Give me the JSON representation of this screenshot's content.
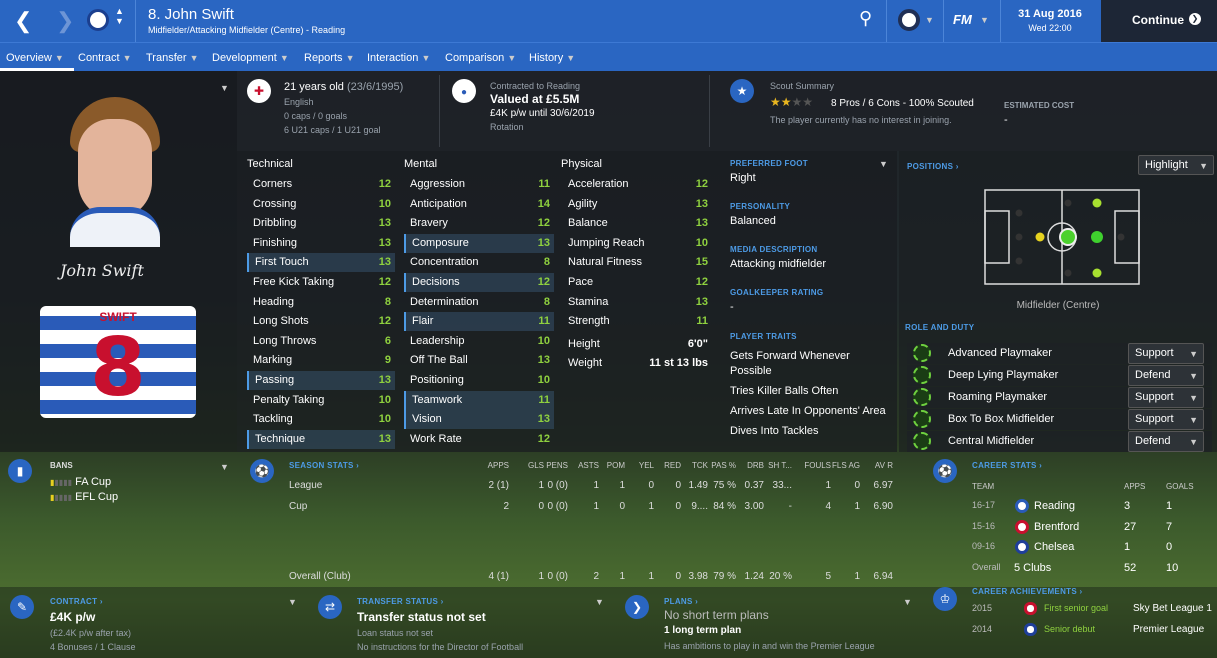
{
  "header": {
    "title": "8. John Swift",
    "subtitle": "Midfielder/Attacking Midfielder (Centre) - Reading",
    "date": "31 Aug 2016",
    "time": "Wed 22:00",
    "continue_label": "Continue",
    "fm_label": "FM"
  },
  "nav": [
    "Overview",
    "Contract",
    "Transfer",
    "Development",
    "Reports",
    "Interaction",
    "Comparison",
    "History"
  ],
  "profile": {
    "age": "21 years old",
    "dob": "(23/6/1995)",
    "nationality": "English",
    "caps": "0 caps / 0 goals",
    "u21": "6 U21 caps / 1 U21 goal",
    "signature": "John Swift",
    "shirt_name": "SWIFT",
    "shirt_number": "8"
  },
  "contract_top": {
    "label": "Contracted to Reading",
    "value": "Valued at £5.5M",
    "wage": "£4K p/w until 30/6/2019",
    "role": "Rotation"
  },
  "scout": {
    "title": "Scout Summary",
    "summary": "8 Pros / 6 Cons - 100% Scouted",
    "interest": "The player currently has no interest in joining.",
    "cost_label": "ESTIMATED COST",
    "cost": "-",
    "stars": 2,
    "max_stars": 4
  },
  "attributes": {
    "technical_title": "Technical",
    "mental_title": "Mental",
    "physical_title": "Physical",
    "technical": [
      [
        "Corners",
        "12"
      ],
      [
        "Crossing",
        "10"
      ],
      [
        "Dribbling",
        "13"
      ],
      [
        "Finishing",
        "13"
      ],
      [
        "First Touch",
        "13"
      ],
      [
        "Free Kick Taking",
        "12"
      ],
      [
        "Heading",
        "8"
      ],
      [
        "Long Shots",
        "12"
      ],
      [
        "Long Throws",
        "6"
      ],
      [
        "Marking",
        "9"
      ],
      [
        "Passing",
        "13"
      ],
      [
        "Penalty Taking",
        "10"
      ],
      [
        "Tackling",
        "10"
      ],
      [
        "Technique",
        "13"
      ]
    ],
    "mental": [
      [
        "Aggression",
        "11"
      ],
      [
        "Anticipation",
        "14"
      ],
      [
        "Bravery",
        "12"
      ],
      [
        "Composure",
        "13"
      ],
      [
        "Concentration",
        "8"
      ],
      [
        "Decisions",
        "12"
      ],
      [
        "Determination",
        "8"
      ],
      [
        "Flair",
        "11"
      ],
      [
        "Leadership",
        "10"
      ],
      [
        "Off The Ball",
        "13"
      ],
      [
        "Positioning",
        "10"
      ],
      [
        "Teamwork",
        "11"
      ],
      [
        "Vision",
        "13"
      ],
      [
        "Work Rate",
        "12"
      ]
    ],
    "physical": [
      [
        "Acceleration",
        "12"
      ],
      [
        "Agility",
        "13"
      ],
      [
        "Balance",
        "13"
      ],
      [
        "Jumping Reach",
        "10"
      ],
      [
        "Natural Fitness",
        "15"
      ],
      [
        "Pace",
        "12"
      ],
      [
        "Stamina",
        "13"
      ],
      [
        "Strength",
        "11"
      ]
    ],
    "height_label": "Height",
    "height": "6'0\"",
    "weight_label": "Weight",
    "weight": "11 st 13 lbs"
  },
  "info": {
    "foot_label": "PREFERRED FOOT",
    "foot": "Right",
    "personality_label": "PERSONALITY",
    "personality": "Balanced",
    "media_label": "MEDIA DESCRIPTION",
    "media": "Attacking midfielder",
    "gk_label": "GOALKEEPER RATING",
    "gk": "-",
    "traits_label": "PLAYER TRAITS",
    "traits": [
      "Gets Forward Whenever Possible",
      "Tries Killer Balls Often",
      "Arrives Late In Opponents' Area",
      "Dives Into Tackles"
    ]
  },
  "positions": {
    "label": "POSITIONS",
    "highlight": "Highlight",
    "position_name": "Midfielder (Centre)",
    "role_label": "ROLE AND DUTY",
    "roles": [
      [
        "Advanced Playmaker",
        "Support"
      ],
      [
        "Deep Lying Playmaker",
        "Defend"
      ],
      [
        "Roaming Playmaker",
        "Support"
      ],
      [
        "Box To Box Midfielder",
        "Support"
      ],
      [
        "Central Midfielder",
        "Defend"
      ]
    ]
  },
  "bans": {
    "label": "BANS",
    "items": [
      "FA Cup",
      "EFL Cup"
    ]
  },
  "season": {
    "label": "SEASON STATS",
    "headers": [
      "APPS",
      "GLS",
      "PENS",
      "ASTS",
      "POM",
      "YEL",
      "RED",
      "TCK",
      "PAS %",
      "DRB",
      "SH T...",
      "FOULS",
      "FLS AG",
      "AV R"
    ],
    "rows": [
      [
        "League",
        "2 (1)",
        "1",
        "0 (0)",
        "1",
        "1",
        "0",
        "0",
        "1.49",
        "75 %",
        "0.37",
        "33...",
        "1",
        "0",
        "6.97"
      ],
      [
        "Cup",
        "2",
        "0",
        "0 (0)",
        "1",
        "0",
        "1",
        "0",
        "9....",
        "84 %",
        "3.00",
        "-",
        "4",
        "1",
        "6.90"
      ],
      [
        "Overall (Club)",
        "4 (1)",
        "1",
        "0 (0)",
        "2",
        "1",
        "1",
        "0",
        "3.98",
        "79 %",
        "1.24",
        "20 %",
        "5",
        "1",
        "6.94"
      ]
    ]
  },
  "career": {
    "label": "CAREER STATS",
    "headers": [
      "TEAM",
      "APPS",
      "GOALS"
    ],
    "rows": [
      [
        "16-17",
        "Reading",
        "3",
        "1"
      ],
      [
        "15-16",
        "Brentford",
        "27",
        "7"
      ],
      [
        "09-16",
        "Chelsea",
        "1",
        "0"
      ],
      [
        "Overall",
        "5 Clubs",
        "52",
        "10"
      ]
    ]
  },
  "contract": {
    "label": "CONTRACT",
    "wage": "£4K p/w",
    "after_tax": "(£2.4K p/w after tax)",
    "bonuses": "4 Bonuses / 1 Clause"
  },
  "transfer": {
    "label": "TRANSFER STATUS",
    "status": "Transfer status not set",
    "loan": "Loan status not set",
    "note": "No instructions for the Director of Football"
  },
  "plans": {
    "label": "PLANS",
    "short": "No short term plans",
    "long": "1 long term plan",
    "ambition": "Has ambitions to play in and win the Premier League"
  },
  "achievements": {
    "label": "CAREER ACHIEVEMENTS",
    "rows": [
      [
        "2015",
        "First senior goal",
        "Sky Bet League 1"
      ],
      [
        "2014",
        "Senior debut",
        "Premier League"
      ]
    ]
  },
  "colors": {
    "accent": "#2a66c2",
    "link": "#4d9be6",
    "attr_green": "#8fd13f"
  }
}
